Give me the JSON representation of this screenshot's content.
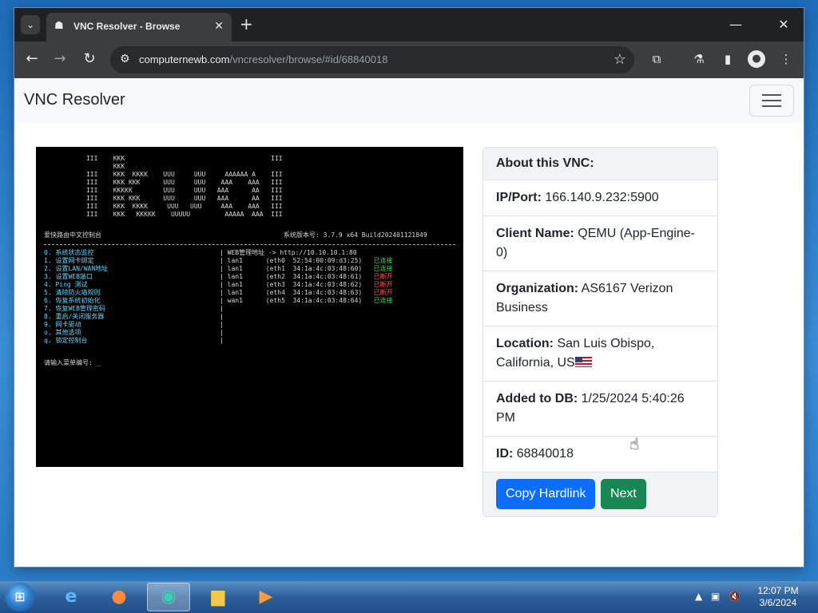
{
  "browser": {
    "tab_title": "VNC Resolver - Browse",
    "url_host": "computernewb.com",
    "url_path": "/vncresolver/browse/#id/68840018"
  },
  "page": {
    "brand": "VNC Resolver",
    "card": {
      "header": "About this VNC:",
      "ip_label": "IP/Port:",
      "ip_value": "166.140.9.232:5900",
      "client_label": "Client Name:",
      "client_value": "QEMU (App-Engine-0)",
      "org_label": "Organization:",
      "org_value": "AS6167 Verizon Business",
      "location_label": "Location:",
      "location_value": "San Luis Obispo, California, US",
      "added_label": "Added to DB:",
      "added_value": "1/25/2024 5:40:26 PM",
      "id_label": "ID:",
      "id_value": "68840018",
      "copy_button": "Copy Hardlink",
      "next_button": "Next"
    },
    "terminal": {
      "title_left": "爱快路由中文控制台",
      "title_right": "系统版本号: 3.7.9 x64 Build202401121849",
      "menu": [
        "0. 系统状态监控",
        "1. 设置网卡绑定",
        "2. 设置LAN/WAN地址",
        "3. 设置WEB端口",
        "4. Ping 测试",
        "5. 清除防火墙规则",
        "6. 恢复系统初始化",
        "7. 恢复WEB管理密码",
        "8. 重启/关闭服务器",
        "9. 网卡驱动",
        "o. 其他选项",
        "q. 锁定控制台"
      ],
      "web_line": "| WEB管理地址 -> http://10.10.10.1:80",
      "nics": [
        {
          "name": "lan1",
          "dev": "(eth0  52:54:00:09:d3:25)",
          "status": "已连接"
        },
        {
          "name": "lan1",
          "dev": "(eth1  34:1a:4c:03:48:60)",
          "status": "已连接"
        },
        {
          "name": "lan1",
          "dev": "(eth2  34:1a:4c:03:48:61)",
          "status": "已断开"
        },
        {
          "name": "lan1",
          "dev": "(eth3  34:1a:4c:03:48:62)",
          "status": "已断开"
        },
        {
          "name": "lan1",
          "dev": "(eth4  34:1a:4c:03:48:63)",
          "status": "已断开"
        },
        {
          "name": "wan1",
          "dev": "(eth5  34:1a:4c:03:48:64)",
          "status": "已连接"
        }
      ],
      "prompt": "请输入菜单编号: _"
    }
  },
  "taskbar": {
    "time": "12:07 PM",
    "date": "3/6/2024"
  },
  "colors": {
    "primary": "#0d6efd",
    "success": "#198754",
    "chrome_dark": "#202124"
  }
}
